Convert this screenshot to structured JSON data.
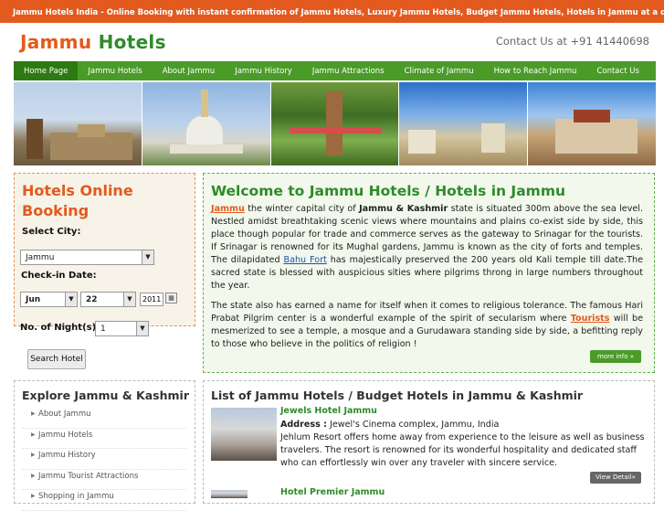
{
  "topbar": {
    "text": "Jammu Hotels India - Online Booking with instant confirmation of Jammu Hotels, Luxury Jammu Hotels, Budget Jammu Hotels, Hotels in Jammu at a discounted rates!"
  },
  "header": {
    "logo_part1": "Jammu",
    "logo_part2": "Hotels",
    "contact": "Contact Us at +91 41440698"
  },
  "nav": {
    "items": [
      "Home Page",
      "Jammu Hotels",
      "About Jammu",
      "Jammu History",
      "Jammu Attractions",
      "Climate of Jammu",
      "How to Reach Jammu",
      "Contact Us"
    ]
  },
  "booking": {
    "title": "Hotels Online Booking",
    "city_label": "Select City:",
    "city_value": "Jammu",
    "checkin_label": "Check-in Date:",
    "month": "Jun",
    "day": "22",
    "year": "2011",
    "nights_label": "No. of Night(s):",
    "nights_value": "1",
    "search_label": "Search Hotel"
  },
  "welcome": {
    "title": "Welcome to Jammu Hotels / Hotels in Jammu",
    "p1_link": "Jammu",
    "p1_a": " the winter capital city of ",
    "p1_bold": "Jammu & Kashmir",
    "p1_b": " state is situated 300m above the sea level. Nestled amidst breathtaking scenic views where mountains and plains co-exist side by side, this place though popular for trade and commerce serves as the gateway to Srinagar for the tourists. If Srinagar is renowned for its Mughal gardens, Jammu is known as the city of forts and temples. The dilapidated ",
    "p1_link2": "Bahu Fort",
    "p1_c": " has majestically preserved the 200 years old Kali temple till date.The sacred state is blessed with auspicious sities where pilgrims throng in large numbers throughout the year.",
    "p2_a": "The state also has earned a name for itself when it comes to religious tolerance. The famous Hari Prabat Pilgrim center is a wonderful example of the spirit of secularism where ",
    "p2_link": "Tourists",
    "p2_b": " will be mesmerized to see a temple, a mosque and a Gurudawara standing side by side, a befitting reply to those who believe in the politics of religion !",
    "more_label": "more info »"
  },
  "explore": {
    "title": "Explore Jammu & Kashmir",
    "items": [
      "About Jammu",
      "Jammu Hotels",
      "Jammu History",
      "Jammu Tourist Attractions",
      "Shopping in Jammu"
    ]
  },
  "hotels": {
    "title": "List of Jammu Hotels / Budget Hotels in Jammu & Kashmir",
    "h1_name": "Jewels Hotel Jammu",
    "h1_addr_label": "Address :",
    "h1_addr": " Jewel's Cinema complex, Jammu, India",
    "h1_desc": "Jehlum Resort offers home away from experience to the leisure as well as business travelers. The resort is renowned for its wonderful hospitality and dedicated staff who can effortlessly win over any traveler with sincere service.",
    "view_label": "View Detail»",
    "h2_name": "Hotel Premier Jammu"
  }
}
